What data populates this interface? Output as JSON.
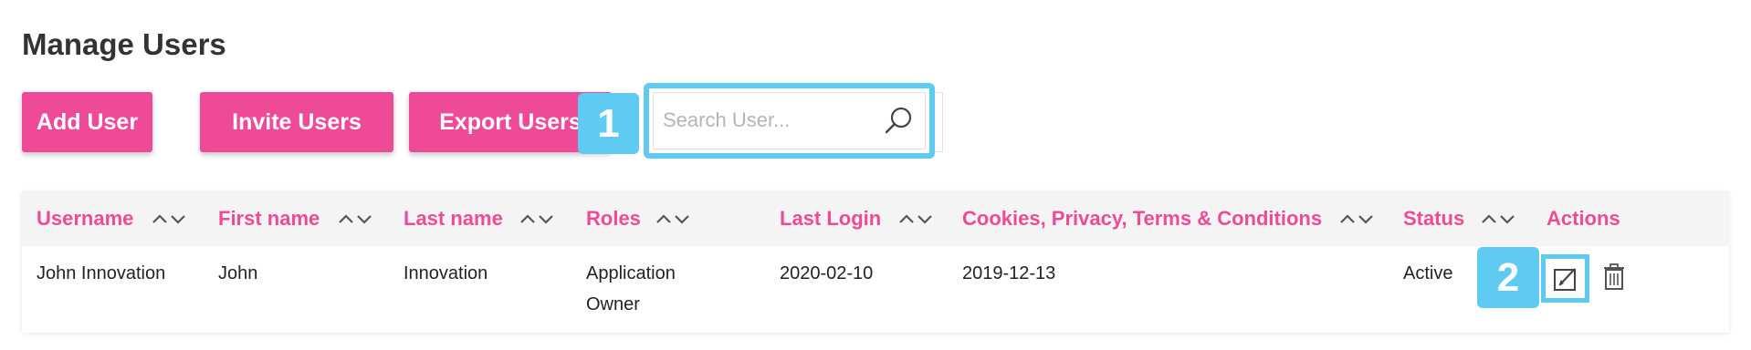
{
  "page": {
    "title": "Manage Users"
  },
  "toolbar": {
    "add_label": "Add User",
    "invite_label": "Invite Users",
    "export_label": "Export Users",
    "search_placeholder": "Search User...",
    "search_value": ""
  },
  "callouts": {
    "one": "1",
    "two": "2"
  },
  "table": {
    "columns": [
      {
        "label": "Username",
        "sortable": true
      },
      {
        "label": "First name",
        "sortable": true
      },
      {
        "label": "Last name",
        "sortable": true
      },
      {
        "label": "Roles",
        "sortable": true
      },
      {
        "label": "Last Login",
        "sortable": true
      },
      {
        "label": "Cookies, Privacy, Terms & Conditions",
        "sortable": true
      },
      {
        "label": "Status",
        "sortable": true
      },
      {
        "label": "Actions",
        "sortable": false
      }
    ],
    "rows": [
      {
        "username": "John Innovation",
        "first_name": "John",
        "last_name": "Innovation",
        "roles_line1": "Application",
        "roles_line2": "Owner",
        "last_login": "2020-02-10",
        "cookies_privacy": "2019-12-13",
        "status": "Active",
        "actions": [
          "edit-icon",
          "trash-icon"
        ]
      }
    ]
  },
  "colors": {
    "accent": "#ee4a98",
    "callout": "#5fcbf3",
    "header_bg": "#f4f4f4"
  }
}
